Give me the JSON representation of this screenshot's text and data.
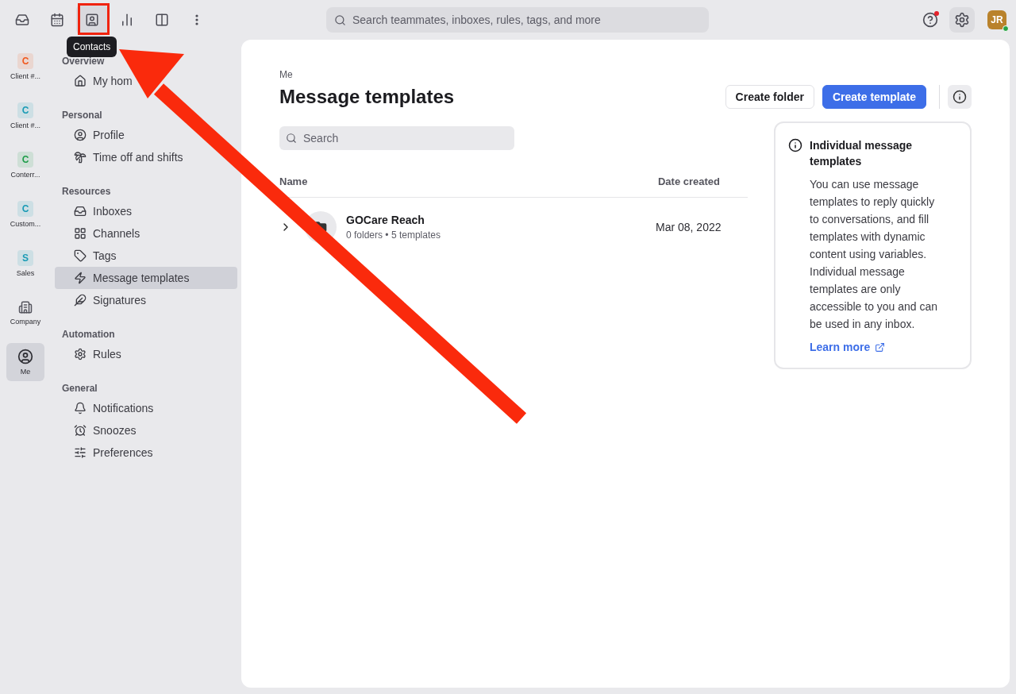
{
  "top_nav": {
    "icons": [
      {
        "kind": "inbox",
        "selected": false
      },
      {
        "kind": "calendar",
        "selected": false
      },
      {
        "kind": "contacts",
        "selected": true
      },
      {
        "kind": "analytics",
        "selected": false
      },
      {
        "kind": "book",
        "selected": false
      },
      {
        "kind": "more",
        "selected": false
      }
    ],
    "tooltip": "Contacts",
    "search": {
      "placeholder": "Search teammates, inboxes, rules, tags, and more"
    },
    "help_unread": true,
    "avatar": {
      "initials": "JR",
      "online": true
    }
  },
  "workspaces": [
    {
      "kind": "letter",
      "initial": "C",
      "label": "Client #...",
      "color": "#f0591e",
      "selected": false
    },
    {
      "kind": "letter",
      "initial": "C",
      "label": "Client #...",
      "color": "#1a9bb5",
      "selected": false
    },
    {
      "kind": "letter",
      "initial": "C",
      "label": "Conterr...",
      "color": "#1f9d4a",
      "selected": false
    },
    {
      "kind": "letter",
      "initial": "C",
      "label": "Custom...",
      "color": "#1a9bb5",
      "selected": false
    },
    {
      "kind": "letter",
      "initial": "S",
      "label": "Sales",
      "color": "#1a9bb5",
      "selected": false
    },
    {
      "kind": "company",
      "label": "Company",
      "selected": false
    },
    {
      "kind": "me",
      "label": "Me",
      "selected": true
    }
  ],
  "sidebar": {
    "sections": [
      {
        "title": "Overview",
        "items": [
          {
            "kind": "home",
            "label": "My hom",
            "selected": false
          }
        ]
      },
      {
        "title": "Personal",
        "items": [
          {
            "kind": "profile",
            "label": "Profile",
            "selected": false
          },
          {
            "kind": "palm",
            "label": "Time off and shifts",
            "selected": false
          }
        ]
      },
      {
        "title": "Resources",
        "items": [
          {
            "kind": "inbox",
            "label": "Inboxes",
            "selected": false
          },
          {
            "kind": "grid",
            "label": "Channels",
            "selected": false
          },
          {
            "kind": "tag",
            "label": "Tags",
            "selected": false
          },
          {
            "kind": "template",
            "label": "Message templates",
            "selected": true
          },
          {
            "kind": "feather",
            "label": "Signatures",
            "selected": false
          }
        ]
      },
      {
        "title": "Automation",
        "items": [
          {
            "kind": "gear",
            "label": "Rules",
            "selected": false
          }
        ]
      },
      {
        "title": "General",
        "items": [
          {
            "kind": "bell",
            "label": "Notifications",
            "selected": false
          },
          {
            "kind": "alarm",
            "label": "Snoozes",
            "selected": false
          },
          {
            "kind": "sliders",
            "label": "Preferences",
            "selected": false
          }
        ]
      }
    ]
  },
  "main": {
    "breadcrumb": "Me",
    "title": "Message templates",
    "buttons": [
      {
        "label": "Create folder",
        "kind": "secondary"
      },
      {
        "label": "Create template",
        "kind": "primary"
      }
    ],
    "search": {
      "placeholder": "Search"
    },
    "table": {
      "columns": [
        "Name",
        "Date created"
      ],
      "rows": [
        {
          "name": "GOCare Reach",
          "meta": "0 folders • 5 templates",
          "date": "Mar 08, 2022",
          "expanded": false
        }
      ]
    },
    "info_card": {
      "title": "Individual message templates",
      "body": "You can use message templates to reply quickly to conversations, and fill templates with dynamic content using variables. Individual message templates are only accessible to you and can be used in any inbox.",
      "link": "Learn more"
    }
  }
}
